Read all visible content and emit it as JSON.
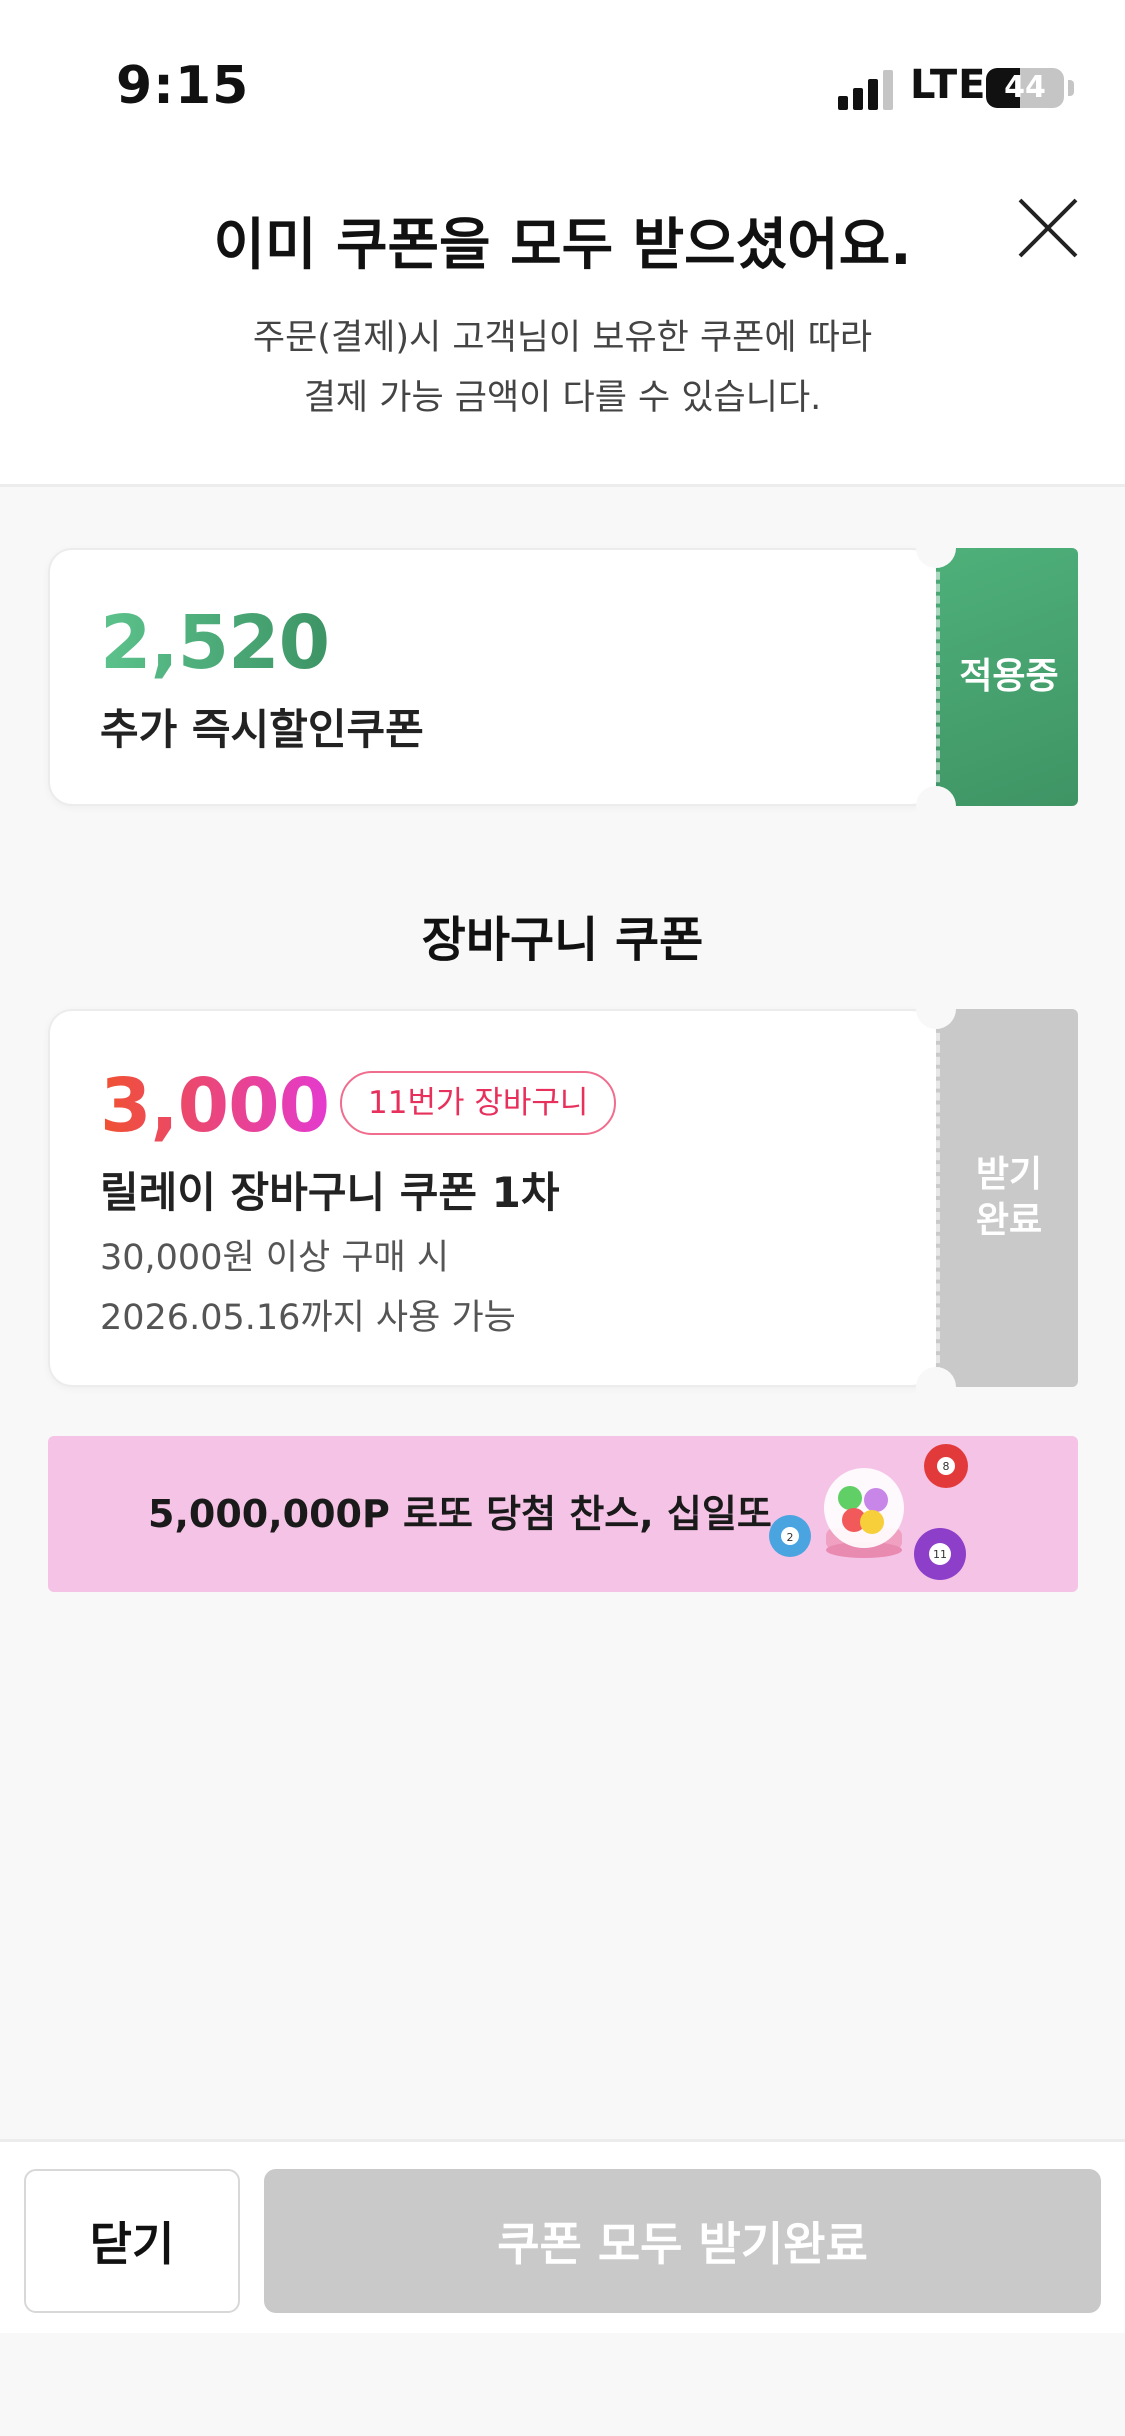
{
  "status_bar": {
    "time": "9:15",
    "network": "LTE",
    "battery_level": "44",
    "battery_fraction": 0.44
  },
  "header": {
    "title": "이미 쿠폰을 모두 받으셨어요.",
    "description_line1": "주문(결제)시 고객님이 보유한 쿠폰에 따라",
    "description_line2": "결제 가능 금액이 다를 수 있습니다.",
    "close_icon": "close-icon"
  },
  "coupons": [
    {
      "amount": "2,520",
      "name": "추가 즉시할인쿠폰",
      "status": "적용중",
      "status_color": "#4eb07a",
      "amount_colors": [
        "#5cc28c",
        "#3d9465"
      ]
    }
  ],
  "cart_section": {
    "title": "장바구니 쿠폰",
    "coupons": [
      {
        "amount": "3,000",
        "tag": "11번가 장바구니",
        "name": "릴레이 장바구니 쿠폰 1차",
        "condition": "30,000원 이상 구매 시",
        "expiry": "2026.05.16까지 사용 가능",
        "status": "받기 완료",
        "status_color": "#c9c9c9",
        "amount_colors": [
          "#f0512f",
          "#e43ad0"
        ]
      }
    ]
  },
  "banner": {
    "text": "5,000,000P 로또 당첨 찬스, 십일또",
    "background": "#f5c3e6",
    "icon": "lotto-machine-icon"
  },
  "footer": {
    "close_label": "닫기",
    "get_all_label": "쿠폰 모두 받기완료"
  }
}
